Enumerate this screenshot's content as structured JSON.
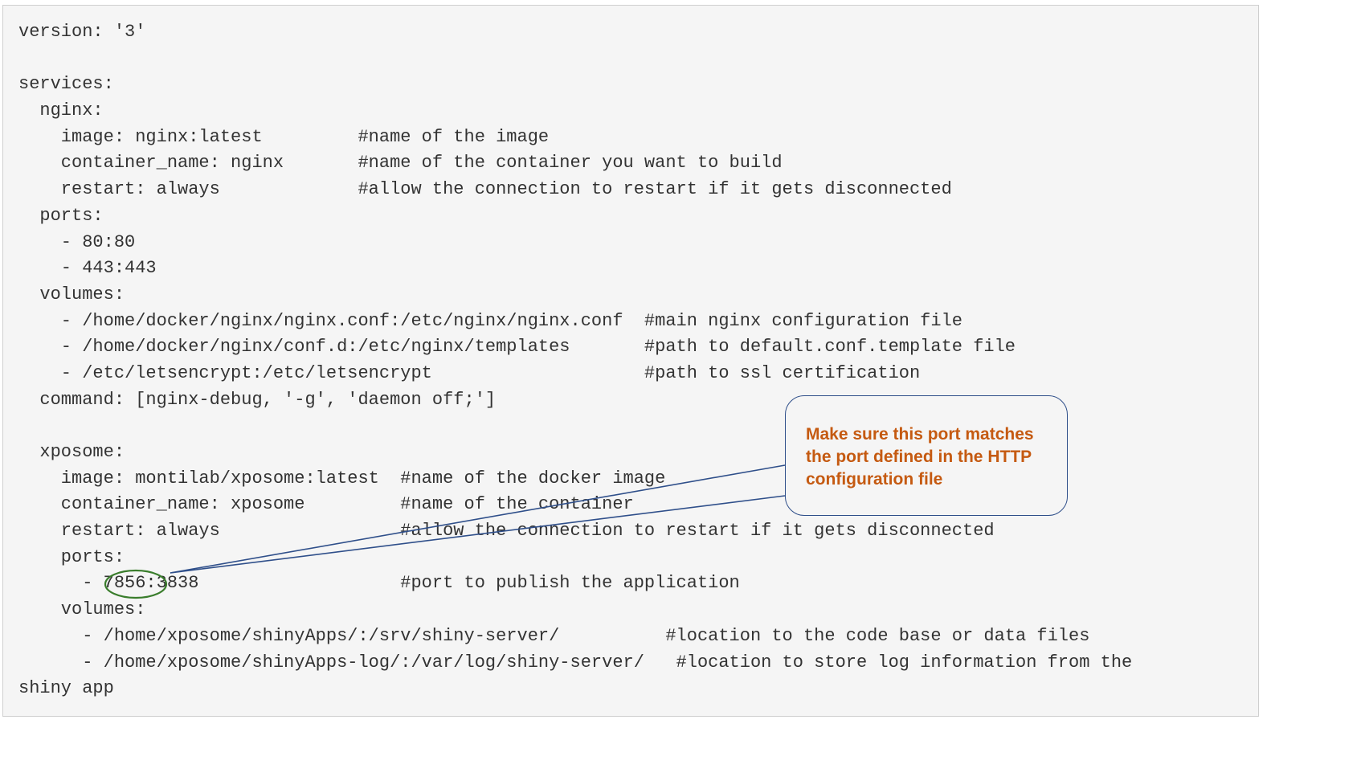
{
  "code": {
    "lines": [
      "version: '3'",
      "",
      "services:",
      "  nginx:",
      "    image: nginx:latest         #name of the image",
      "    container_name: nginx       #name of the container you want to build",
      "    restart: always             #allow the connection to restart if it gets disconnected",
      "  ports:",
      "    - 80:80",
      "    - 443:443",
      "  volumes:",
      "    - /home/docker/nginx/nginx.conf:/etc/nginx/nginx.conf  #main nginx configuration file",
      "    - /home/docker/nginx/conf.d:/etc/nginx/templates       #path to default.conf.template file",
      "    - /etc/letsencrypt:/etc/letsencrypt                    #path to ssl certification",
      "  command: [nginx-debug, '-g', 'daemon off;']",
      "",
      "  xposome:",
      "    image: montilab/xposome:latest  #name of the docker image",
      "    container_name: xposome         #name of the container",
      "    restart: always                 #allow the connection to restart if it gets disconnected",
      "    ports:",
      "      - 7856:3838                   #port to publish the application",
      "    volumes:",
      "      - /home/xposome/shinyApps/:/srv/shiny-server/          #location to the code base or data files",
      "      - /home/xposome/shinyApps-log/:/var/log/shiny-server/   #location to store log information from the",
      "shiny app"
    ]
  },
  "callout": {
    "text": "Make sure this port matches the port defined in the HTTP configuration file",
    "highlighted_port": "7856",
    "text_color": "#c55a11",
    "border_color": "#2f4f8a",
    "ellipse_color": "#3a7d2c"
  }
}
